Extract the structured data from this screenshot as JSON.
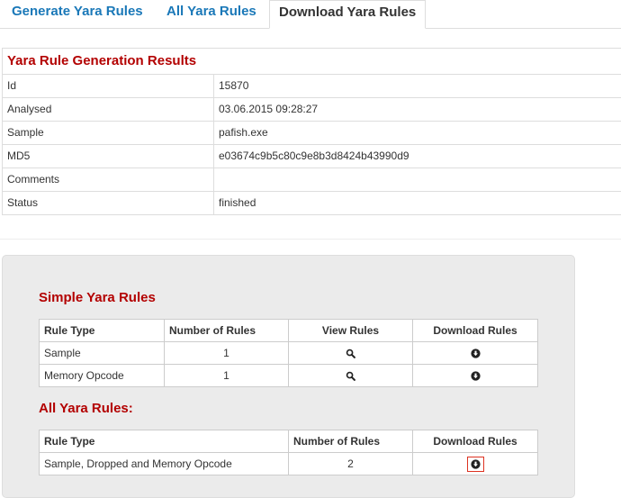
{
  "tabs": [
    {
      "label": "Generate Yara Rules"
    },
    {
      "label": "All Yara Rules"
    },
    {
      "label": "Download Yara Rules"
    }
  ],
  "results": {
    "title": "Yara Rule Generation Results",
    "rows": [
      {
        "key": "Id",
        "value": "15870"
      },
      {
        "key": "Analysed",
        "value": "03.06.2015 09:28:27"
      },
      {
        "key": "Sample",
        "value": "pafish.exe"
      },
      {
        "key": "MD5",
        "value": "e03674c9b5c80c9e8b3d8424b43990d9"
      },
      {
        "key": "Comments",
        "value": ""
      },
      {
        "key": "Status",
        "value": "finished"
      }
    ]
  },
  "simple": {
    "title": "Simple Yara Rules",
    "headers": [
      "Rule Type",
      "Number of Rules",
      "View Rules",
      "Download Rules"
    ],
    "rows": [
      {
        "type": "Sample",
        "count": "1"
      },
      {
        "type": "Memory Opcode",
        "count": "1"
      }
    ]
  },
  "all": {
    "title": "All Yara Rules:",
    "headers": [
      "Rule Type",
      "Number of Rules",
      "Download Rules"
    ],
    "rows": [
      {
        "type": "Sample, Dropped and Memory Opcode",
        "count": "2"
      }
    ]
  },
  "icons": {
    "view": "search-icon",
    "download": "download-circle-icon"
  },
  "colors": {
    "accent_red": "#b30000",
    "tab_blue": "#1a78b8",
    "panel_gray": "#ebebeb"
  }
}
